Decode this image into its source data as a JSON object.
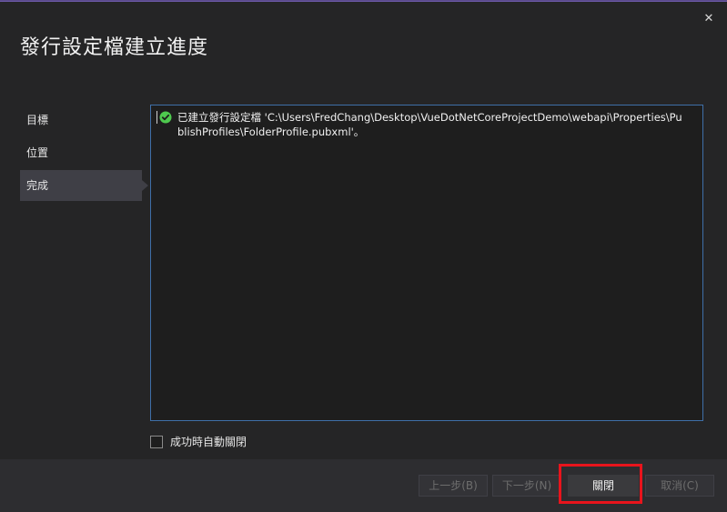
{
  "dialog": {
    "title": "發行設定檔建立進度",
    "close_glyph": "✕"
  },
  "steps": [
    {
      "label": "目標",
      "active": false
    },
    {
      "label": "位置",
      "active": false
    },
    {
      "label": "完成",
      "active": true
    }
  ],
  "log": {
    "status_icon": "check-circle-icon",
    "status_color": "#4ec94e",
    "message": "已建立發行設定檔 'C:\\Users\\FredChang\\Desktop\\VueDotNetCoreProjectDemo\\webapi\\Properties\\PublishProfiles\\FolderProfile.pubxml'。"
  },
  "auto_close": {
    "label": "成功時自動關閉",
    "checked": false
  },
  "buttons": {
    "prev": "上一步(B)",
    "next": "下一步(N)",
    "close": "關閉",
    "cancel": "取消(C)"
  },
  "colors": {
    "accent_border": "#3f6fa8",
    "highlight": "#e8141c"
  }
}
